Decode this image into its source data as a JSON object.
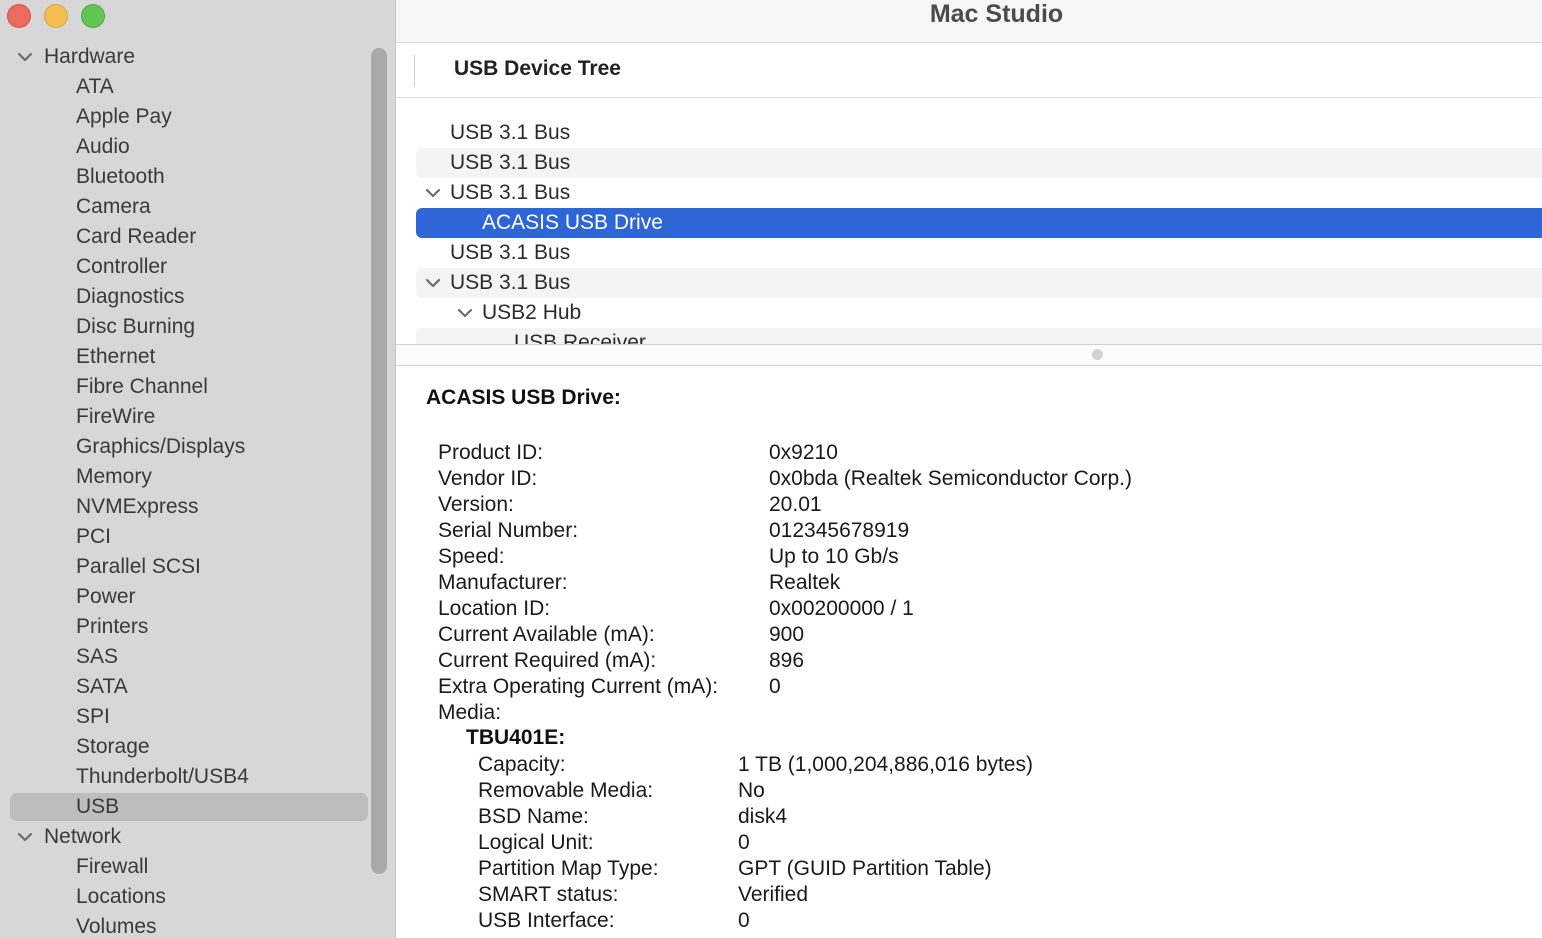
{
  "window": {
    "title": "Mac Studio"
  },
  "sidebar": {
    "groups": [
      {
        "label": "Hardware",
        "items": [
          "ATA",
          "Apple Pay",
          "Audio",
          "Bluetooth",
          "Camera",
          "Card Reader",
          "Controller",
          "Diagnostics",
          "Disc Burning",
          "Ethernet",
          "Fibre Channel",
          "FireWire",
          "Graphics/Displays",
          "Memory",
          "NVMExpress",
          "PCI",
          "Parallel SCSI",
          "Power",
          "Printers",
          "SAS",
          "SATA",
          "SPI",
          "Storage",
          "Thunderbolt/USB4",
          "USB"
        ]
      },
      {
        "label": "Network",
        "items": [
          "Firewall",
          "Locations",
          "Volumes"
        ]
      }
    ],
    "selected": "USB"
  },
  "tree": {
    "header": "USB Device Tree",
    "rows": [
      {
        "label": "USB 3.1 Bus",
        "level": 0,
        "expanded": false
      },
      {
        "label": "USB 3.1 Bus",
        "level": 0,
        "expanded": false
      },
      {
        "label": "USB 3.1 Bus",
        "level": 0,
        "expanded": true
      },
      {
        "label": "ACASIS USB Drive",
        "level": 1,
        "selected": true
      },
      {
        "label": "USB 3.1 Bus",
        "level": 0,
        "expanded": false
      },
      {
        "label": "USB 3.1 Bus",
        "level": 0,
        "expanded": true
      },
      {
        "label": "USB2 Hub",
        "level": 1,
        "expanded": true
      },
      {
        "label": "USB Receiver",
        "level": 2
      }
    ]
  },
  "detail": {
    "title": "ACASIS USB Drive:",
    "properties": [
      {
        "key": "Product ID:",
        "value": "0x9210"
      },
      {
        "key": "Vendor ID:",
        "value": "0x0bda  (Realtek Semiconductor Corp.)"
      },
      {
        "key": "Version:",
        "value": "20.01"
      },
      {
        "key": "Serial Number:",
        "value": "012345678919"
      },
      {
        "key": "Speed:",
        "value": "Up to 10 Gb/s"
      },
      {
        "key": "Manufacturer:",
        "value": "Realtek"
      },
      {
        "key": "Location ID:",
        "value": "0x00200000 / 1"
      },
      {
        "key": "Current Available (mA):",
        "value": "900"
      },
      {
        "key": "Current Required (mA):",
        "value": "896"
      },
      {
        "key": "Extra Operating Current (mA):",
        "value": "0"
      },
      {
        "key": "Media:",
        "value": ""
      }
    ],
    "media": {
      "name": "TBU401E:",
      "properties": [
        {
          "key": "Capacity:",
          "value": "1 TB (1,000,204,886,016 bytes)"
        },
        {
          "key": "Removable Media:",
          "value": "No"
        },
        {
          "key": "BSD Name:",
          "value": "disk4"
        },
        {
          "key": "Logical Unit:",
          "value": "0"
        },
        {
          "key": "Partition Map Type:",
          "value": "GPT (GUID Partition Table)"
        },
        {
          "key": "SMART status:",
          "value": "Verified"
        },
        {
          "key": "USB Interface:",
          "value": "0"
        }
      ]
    }
  },
  "colors": {
    "selection": "#2e66d8",
    "sidebar_bg": "#d7d7d7",
    "sidebar_selected": "#bdbdbd"
  },
  "icons": {
    "disclosure": "chevron-down-icon"
  }
}
